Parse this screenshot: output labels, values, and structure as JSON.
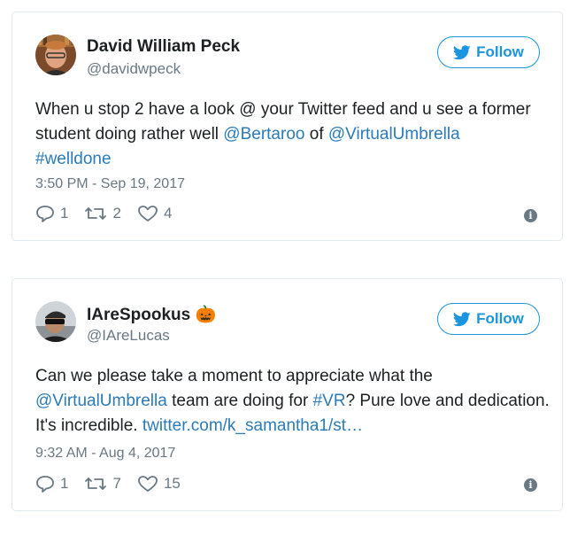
{
  "colors": {
    "link": "#2b7bb9",
    "follow": "#1b95e0",
    "muted": "#697882",
    "border": "#e1e8ed"
  },
  "tweets": [
    {
      "name": "David William Peck",
      "name_emoji": "",
      "handle": "@davidwpeck",
      "follow_label": "Follow",
      "text_parts": [
        {
          "t": "When u stop 2 have a look @ your Twitter feed and u see a former student doing rather well ",
          "link": false
        },
        {
          "t": "@Bertaroo",
          "link": true
        },
        {
          "t": " of ",
          "link": false
        },
        {
          "t": "@VirtualUmbrella",
          "link": true
        },
        {
          "t": " ",
          "link": false
        },
        {
          "t": "#welldone",
          "link": true
        }
      ],
      "timestamp": "3:50 PM - Sep 19, 2017",
      "reply_count": "1",
      "retweet_count": "2",
      "like_count": "4"
    },
    {
      "name": "IAreSpookus",
      "name_emoji": "🎃",
      "handle": "@IAreLucas",
      "follow_label": "Follow",
      "text_parts": [
        {
          "t": "Can we please take a moment to appreciate what the ",
          "link": false
        },
        {
          "t": "@VirtualUmbrella",
          "link": true
        },
        {
          "t": " team are doing for ",
          "link": false
        },
        {
          "t": "#VR",
          "link": true
        },
        {
          "t": "? Pure love and dedication. It's incredible. ",
          "link": false
        },
        {
          "t": "twitter.com/k_samantha1/st…",
          "link": true
        }
      ],
      "timestamp": "9:32 AM - Aug 4, 2017",
      "reply_count": "1",
      "retweet_count": "7",
      "like_count": "15"
    }
  ]
}
